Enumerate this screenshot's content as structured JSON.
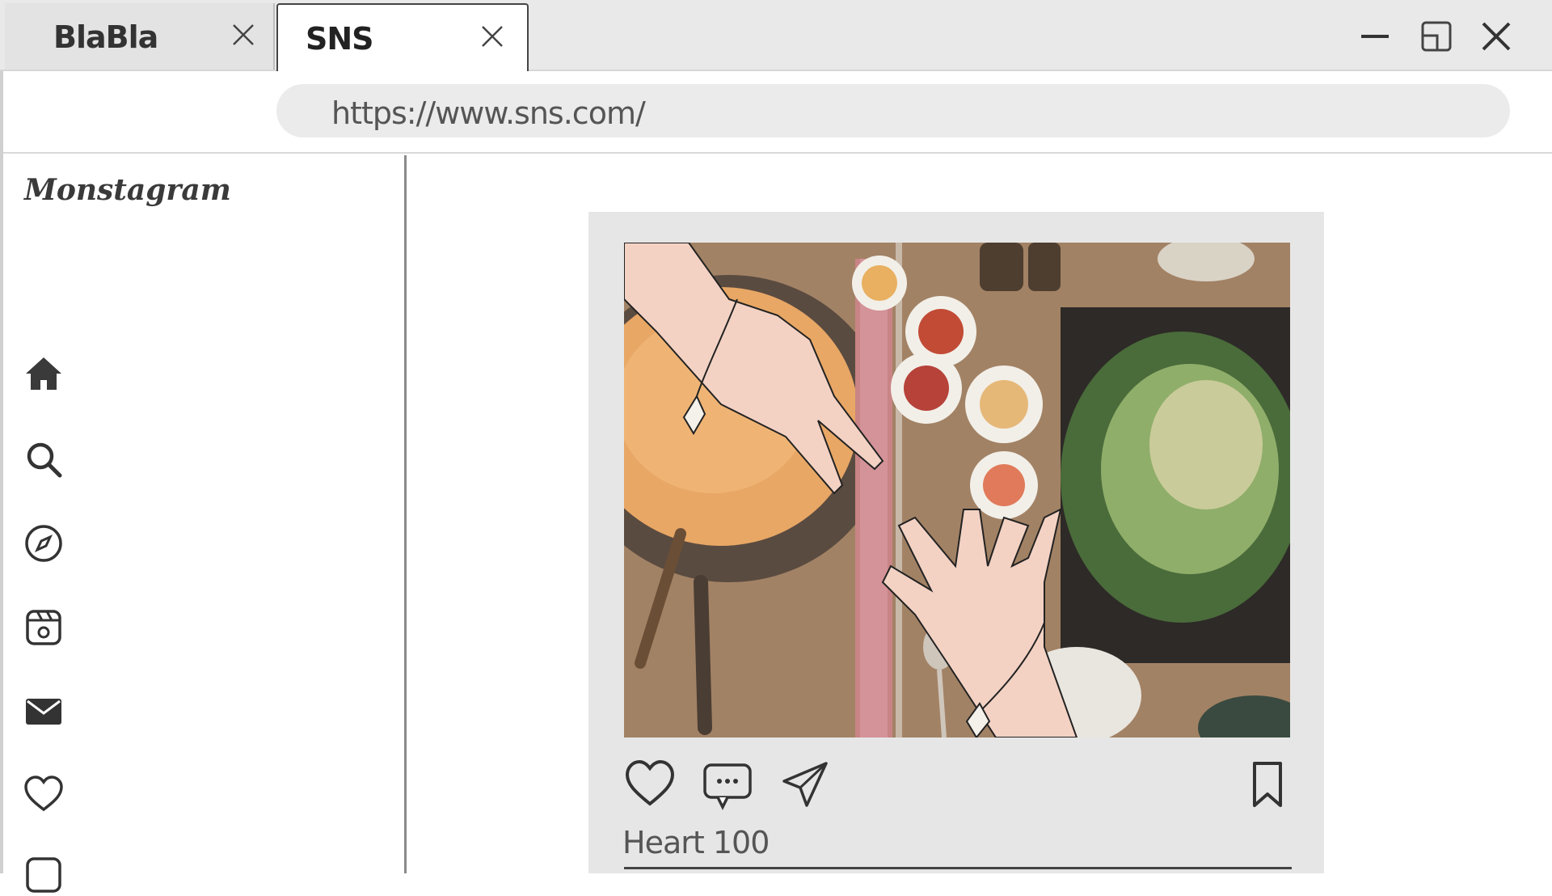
{
  "browser": {
    "tabs": [
      {
        "label": "BlaBla",
        "active": false
      },
      {
        "label": "SNS",
        "active": true
      }
    ],
    "url": "https://www.sns.com/",
    "window_controls": [
      "minimize-icon",
      "restore-icon",
      "close-icon"
    ]
  },
  "sidebar": {
    "logo": "Monstagram",
    "nav": [
      {
        "icon": "home-icon"
      },
      {
        "icon": "search-icon"
      },
      {
        "icon": "explore-compass-icon"
      },
      {
        "icon": "reels-icon"
      },
      {
        "icon": "messages-envelope-icon"
      },
      {
        "icon": "notifications-heart-icon"
      },
      {
        "icon": "create-icon"
      }
    ]
  },
  "post": {
    "image": "food-table-with-hands-photo",
    "actions": [
      "heart-icon",
      "comment-icon",
      "share-icon",
      "bookmark-icon"
    ],
    "likes_text": "Heart 100"
  },
  "colors": {
    "chrome_bg": "#e9e9e9",
    "post_bg": "#e6e6e6",
    "icon": "#333333"
  }
}
